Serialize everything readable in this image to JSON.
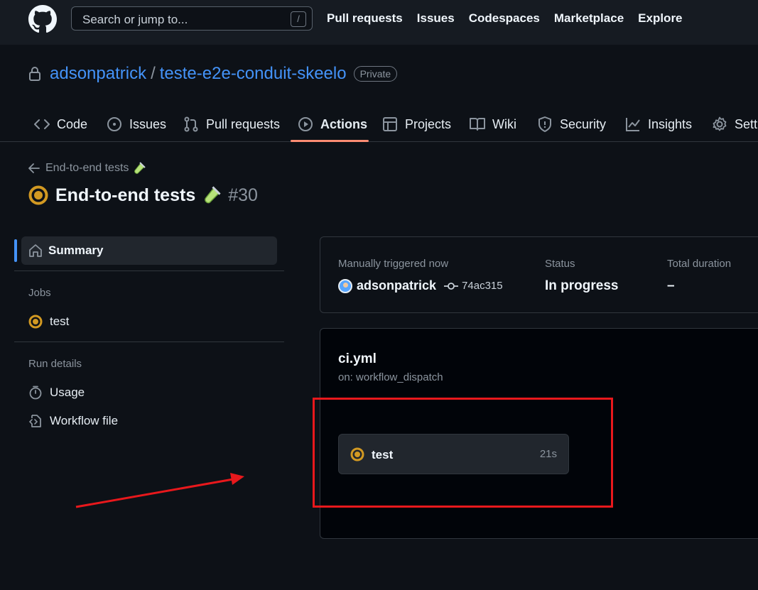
{
  "header": {
    "search_placeholder": "Search or jump to...",
    "search_shortcut": "/",
    "nav": [
      "Pull requests",
      "Issues",
      "Codespaces",
      "Marketplace",
      "Explore"
    ]
  },
  "repo": {
    "owner": "adsonpatrick",
    "separator": "/",
    "name": "teste-e2e-conduit-skeelo",
    "visibility": "Private"
  },
  "tabs": [
    {
      "label": "Code",
      "icon": "code-icon"
    },
    {
      "label": "Issues",
      "icon": "issue-icon"
    },
    {
      "label": "Pull requests",
      "icon": "pull-request-icon"
    },
    {
      "label": "Actions",
      "icon": "play-icon",
      "active": true
    },
    {
      "label": "Projects",
      "icon": "table-icon"
    },
    {
      "label": "Wiki",
      "icon": "book-icon"
    },
    {
      "label": "Security",
      "icon": "shield-icon"
    },
    {
      "label": "Insights",
      "icon": "graph-icon"
    },
    {
      "label": "Setti",
      "icon": "gear-icon"
    }
  ],
  "run": {
    "back_label": "End-to-end tests",
    "title": "End-to-end tests",
    "number": "#30",
    "status_color": "#d29922"
  },
  "sidebar": {
    "summary_label": "Summary",
    "jobs_heading": "Jobs",
    "job_label": "test",
    "run_details_heading": "Run details",
    "usage_label": "Usage",
    "workflow_file_label": "Workflow file"
  },
  "summary_card": {
    "trigger_label": "Manually triggered now",
    "actor": "adsonpatrick",
    "commit": "74ac315",
    "status_label": "Status",
    "status_value": "In progress",
    "duration_label": "Total duration",
    "duration_value": "–"
  },
  "workflow_card": {
    "file": "ci.yml",
    "trigger": "on: workflow_dispatch",
    "job_name": "test",
    "job_duration": "21s"
  },
  "annotation": {
    "color": "#e8181c"
  }
}
